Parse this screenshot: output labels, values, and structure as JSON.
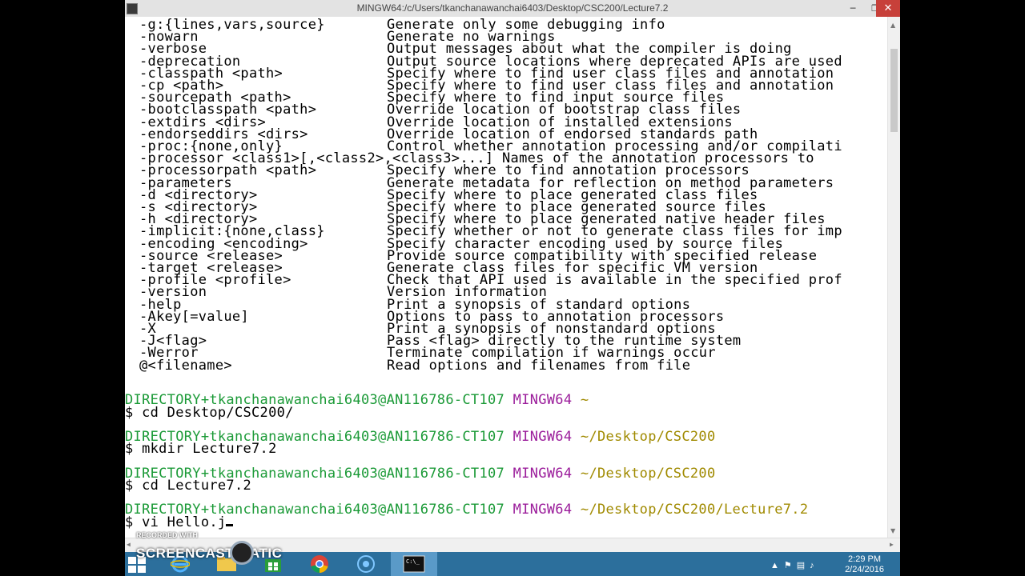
{
  "window": {
    "title": "MINGW64:/c/Users/tkanchanawanchai6403/Desktop/CSC200/Lecture7.2",
    "minimize_icon": "minimize-icon",
    "maximize_icon": "maximize-icon",
    "close_icon": "close-icon"
  },
  "options": [
    {
      "flag": "-g:{lines,vars,source}",
      "desc": "Generate only some debugging info"
    },
    {
      "flag": "-nowarn",
      "desc": "Generate no warnings"
    },
    {
      "flag": "-verbose",
      "desc": "Output messages about what the compiler is doing"
    },
    {
      "flag": "-deprecation",
      "desc": "Output source locations where deprecated APIs are used"
    },
    {
      "flag": "-classpath <path>",
      "desc": "Specify where to find user class files and annotation"
    },
    {
      "flag": "-cp <path>",
      "desc": "Specify where to find user class files and annotation"
    },
    {
      "flag": "-sourcepath <path>",
      "desc": "Specify where to find input source files"
    },
    {
      "flag": "-bootclasspath <path>",
      "desc": "Override location of bootstrap class files"
    },
    {
      "flag": "-extdirs <dirs>",
      "desc": "Override location of installed extensions"
    },
    {
      "flag": "-endorseddirs <dirs>",
      "desc": "Override location of endorsed standards path"
    },
    {
      "flag": "-proc:{none,only}",
      "desc": "Control whether annotation processing and/or compilati"
    },
    {
      "flag": "-processor <class1>[,<class2>,<class3>...] Names of the annotation processors to",
      "desc": ""
    },
    {
      "flag": "-processorpath <path>",
      "desc": "Specify where to find annotation processors"
    },
    {
      "flag": "-parameters",
      "desc": "Generate metadata for reflection on method parameters"
    },
    {
      "flag": "-d <directory>",
      "desc": "Specify where to place generated class files"
    },
    {
      "flag": "-s <directory>",
      "desc": "Specify where to place generated source files"
    },
    {
      "flag": "-h <directory>",
      "desc": "Specify where to place generated native header files"
    },
    {
      "flag": "-implicit:{none,class}",
      "desc": "Specify whether or not to generate class files for imp"
    },
    {
      "flag": "-encoding <encoding>",
      "desc": "Specify character encoding used by source files"
    },
    {
      "flag": "-source <release>",
      "desc": "Provide source compatibility with specified release"
    },
    {
      "flag": "-target <release>",
      "desc": "Generate class files for specific VM version"
    },
    {
      "flag": "-profile <profile>",
      "desc": "Check that API used is available in the specified prof"
    },
    {
      "flag": "-version",
      "desc": "Version information"
    },
    {
      "flag": "-help",
      "desc": "Print a synopsis of standard options"
    },
    {
      "flag": "-Akey[=value]",
      "desc": "Options to pass to annotation processors"
    },
    {
      "flag": "-X",
      "desc": "Print a synopsis of nonstandard options"
    },
    {
      "flag": "-J<flag>",
      "desc": "Pass <flag> directly to the runtime system"
    },
    {
      "flag": "-Werror",
      "desc": "Terminate compilation if warnings occur"
    },
    {
      "flag": "@<filename>",
      "desc": "Read options and filenames from file"
    }
  ],
  "session": [
    {
      "user": "DIRECTORY+tkanchanawanchai6403@AN116786-CT107",
      "host": "MINGW64",
      "path": "~",
      "cmd": "$ cd Desktop/CSC200/"
    },
    {
      "user": "DIRECTORY+tkanchanawanchai6403@AN116786-CT107",
      "host": "MINGW64",
      "path": "~/Desktop/CSC200",
      "cmd": "$ mkdir Lecture7.2"
    },
    {
      "user": "DIRECTORY+tkanchanawanchai6403@AN116786-CT107",
      "host": "MINGW64",
      "path": "~/Desktop/CSC200",
      "cmd": "$ cd Lecture7.2"
    },
    {
      "user": "DIRECTORY+tkanchanawanchai6403@AN116786-CT107",
      "host": "MINGW64",
      "path": "~/Desktop/CSC200/Lecture7.2",
      "cmd": "$ vi Hello.j"
    }
  ],
  "watermark": {
    "recorded": "RECORDED WITH",
    "brand": "SCREENCAST    MATIC"
  },
  "taskbar": {
    "items": [
      "start-icon",
      "internet-explorer-icon",
      "file-explorer-icon",
      "store-icon",
      "chrome-icon",
      "app-icon",
      "terminal-icon"
    ],
    "time": "2:29 PM",
    "date": "2/24/2016",
    "colors": {
      "taskbar": "#2c6f9c",
      "active": "#5a9ac8"
    }
  },
  "colors": {
    "prompt_user": "#1b9a37",
    "prompt_host": "#9b1d9b",
    "prompt_path": "#a08a00"
  }
}
